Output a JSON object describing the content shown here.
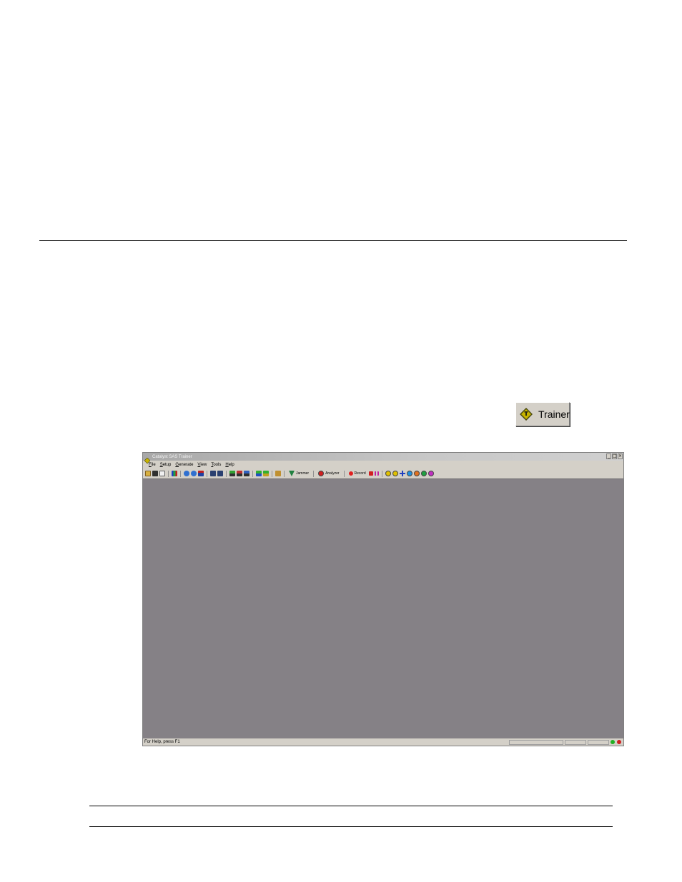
{
  "trainer_button": {
    "label": "Trainer",
    "icon": "trainer-diamond-icon",
    "colors": {
      "diamond": "#c8b400",
      "diamond_border": "#4a4a10"
    }
  },
  "app_window": {
    "title": "Catalyst SAS Trainer",
    "controls": [
      "_",
      "□",
      "×"
    ],
    "menu": [
      "File",
      "Setup",
      "Generate",
      "View",
      "Tools",
      "Help"
    ],
    "toolbar": {
      "jammer_label": "Jammer",
      "analyzer_label": "Analyzer",
      "record_label": "Record"
    },
    "status_text": "For Help, press F1",
    "colors": {
      "workspace": "#858186",
      "chrome": "#d4d0c8",
      "led_green": "#22b022",
      "led_red": "#d02020"
    }
  }
}
